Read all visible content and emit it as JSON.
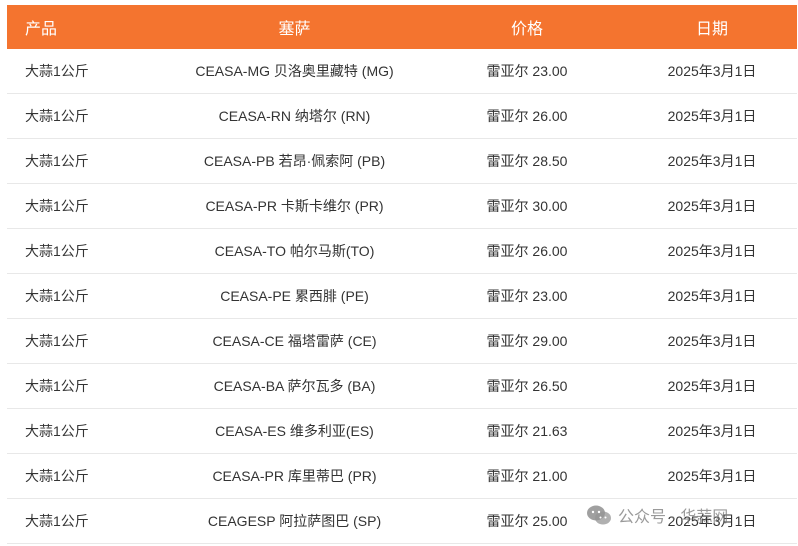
{
  "table": {
    "header": {
      "product": "产品",
      "market": "塞萨",
      "price": "价格",
      "date": "日期"
    },
    "rows": [
      {
        "product": "大蒜1公斤",
        "market": "CEASA-MG 贝洛奥里藏特 (MG)",
        "price": "雷亚尔 23.00",
        "date": "2025年3月1日"
      },
      {
        "product": "大蒜1公斤",
        "market": "CEASA-RN 纳塔尔 (RN)",
        "price": "雷亚尔 26.00",
        "date": "2025年3月1日"
      },
      {
        "product": "大蒜1公斤",
        "market": "CEASA-PB 若昂·佩索阿 (PB)",
        "price": "雷亚尔 28.50",
        "date": "2025年3月1日"
      },
      {
        "product": "大蒜1公斤",
        "market": "CEASA-PR 卡斯卡维尔 (PR)",
        "price": "雷亚尔 30.00",
        "date": "2025年3月1日"
      },
      {
        "product": "大蒜1公斤",
        "market": "CEASA-TO 帕尔马斯(TO)",
        "price": "雷亚尔 26.00",
        "date": "2025年3月1日"
      },
      {
        "product": "大蒜1公斤",
        "market": "CEASA-PE 累西腓 (PE)",
        "price": "雷亚尔 23.00",
        "date": "2025年3月1日"
      },
      {
        "product": "大蒜1公斤",
        "market": "CEASA-CE 福塔雷萨 (CE)",
        "price": "雷亚尔 29.00",
        "date": "2025年3月1日"
      },
      {
        "product": "大蒜1公斤",
        "market": "CEASA-BA 萨尔瓦多 (BA)",
        "price": "雷亚尔 26.50",
        "date": "2025年3月1日"
      },
      {
        "product": "大蒜1公斤",
        "market": "CEASA-ES 维多利亚(ES)",
        "price": "雷亚尔 21.63",
        "date": "2025年3月1日"
      },
      {
        "product": "大蒜1公斤",
        "market": "CEASA-PR 库里蒂巴 (PR)",
        "price": "雷亚尔 21.00",
        "date": "2025年3月1日"
      },
      {
        "product": "大蒜1公斤",
        "market": "CEAGESP 阿拉萨图巴 (SP)",
        "price": "雷亚尔 25.00",
        "date": "2025年3月1日"
      }
    ]
  },
  "watermark": {
    "text": "公众号 · 华蒜网",
    "icon": "wechat-icon"
  },
  "colors": {
    "header_bg": "#f4742f",
    "header_text": "#ffffff",
    "row_border": "#e8e8e8"
  }
}
